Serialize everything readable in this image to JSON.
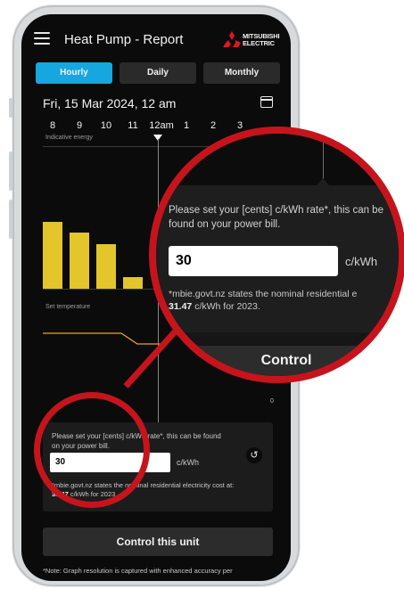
{
  "header": {
    "title": "Heat Pump - Report",
    "logo_text": "MITSUBISHI\nELECTRIC",
    "icons": {
      "menu": "hamburger-menu-icon",
      "logo": "mitsubishi-diamond-logo"
    }
  },
  "tabs": [
    {
      "label": "Hourly",
      "active": true
    },
    {
      "label": "Daily",
      "active": false
    },
    {
      "label": "Monthly",
      "active": false
    }
  ],
  "date_label": "Fri, 15 Mar 2024, 12 am",
  "hours": [
    "8",
    "9",
    "10",
    "11",
    "12am",
    "1",
    "2",
    "3"
  ],
  "chart": {
    "energy_label": "Indicative energy",
    "set_temp_label": "Set temperature",
    "zero_label": "0",
    "colors": {
      "bars": "#e3c52c",
      "line": "#f0a023"
    }
  },
  "chart_data": {
    "type": "bar",
    "categories": [
      "8",
      "9",
      "10",
      "11",
      "12am"
    ],
    "values": [
      1.0,
      0.84,
      0.67,
      0.17,
      0.0
    ],
    "ylim": [
      0,
      1
    ],
    "title": "",
    "xlabel": "",
    "ylabel": "Indicative energy"
  },
  "rate_card": {
    "prompt": "Please set your [cents] c/kWh rate*, this can be found on your power bill.",
    "value": "30",
    "unit": "c/kWh",
    "note_prefix": "*mbie.govt.nz states the nominal residential electricity cost at:",
    "note_value": "31.47",
    "note_suffix": "c/kWh for 2023."
  },
  "control_button": "Control this unit",
  "footnote": "*Note: Graph resolution is captured with enhanced accuracy per",
  "zoom": {
    "prompt": "Please set your [cents] c/kWh rate*, this can be found on your power bill.",
    "value": "30",
    "unit": "c/kWh",
    "note_prefix": "*mbie.govt.nz states the nominal residential e",
    "note_value": "31.47",
    "note_suffix": "c/kWh for 2023.",
    "button_partial": "Control",
    "ring_color": "#c6141c"
  }
}
